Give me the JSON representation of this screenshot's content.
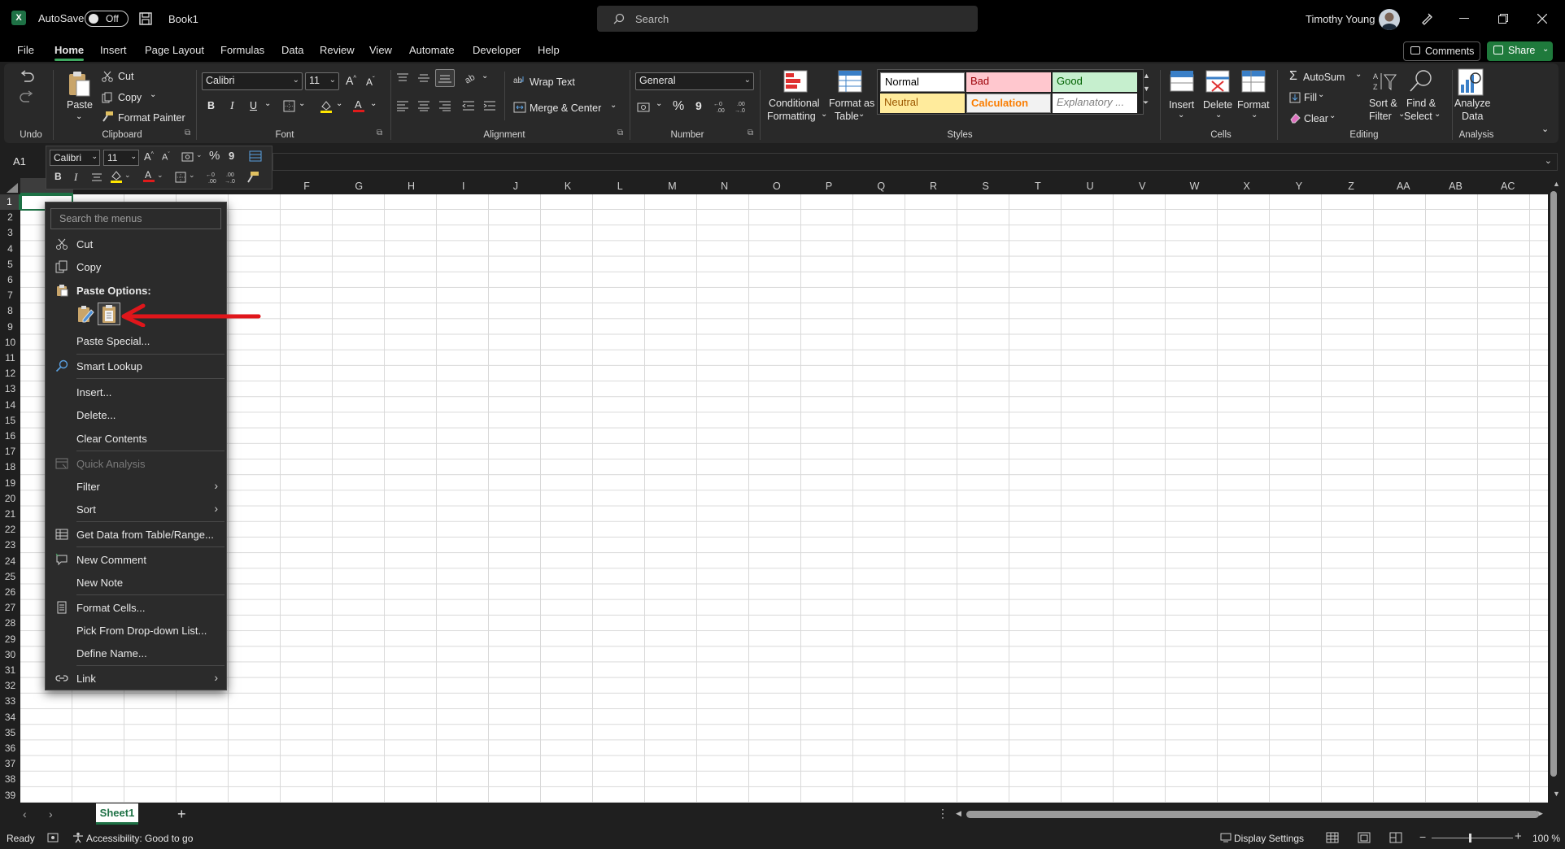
{
  "titlebar": {
    "autosave_label": "AutoSave",
    "autosave_state": "Off",
    "doc_title": "Book1",
    "search_placeholder": "Search",
    "user_name": "Timothy Young"
  },
  "tabs": [
    "File",
    "Home",
    "Insert",
    "Page Layout",
    "Formulas",
    "Data",
    "Review",
    "View",
    "Automate",
    "Developer",
    "Help"
  ],
  "active_tab": "Home",
  "header_buttons": {
    "comments": "Comments",
    "share": "Share"
  },
  "ribbon": {
    "undo_group": "Undo",
    "clipboard": {
      "paste": "Paste",
      "cut": "Cut",
      "copy": "Copy",
      "format_painter": "Format Painter",
      "group": "Clipboard"
    },
    "font": {
      "family": "Calibri",
      "size": "11",
      "bold": "B",
      "italic": "I",
      "underline": "U",
      "group": "Font"
    },
    "alignment": {
      "wrap": "Wrap Text",
      "merge": "Merge & Center",
      "group": "Alignment"
    },
    "number": {
      "format": "General",
      "percent": "%",
      "comma": "9",
      "group": "Number"
    },
    "styles": {
      "conditional_1": "Conditional",
      "conditional_2": "Formatting",
      "format_table_1": "Format as",
      "format_table_2": "Table",
      "normal": "Normal",
      "bad": "Bad",
      "good": "Good",
      "neutral": "Neutral",
      "calculation": "Calculation",
      "explanatory": "Explanatory ...",
      "group": "Styles"
    },
    "cells": {
      "insert": "Insert",
      "delete": "Delete",
      "format": "Format",
      "group": "Cells"
    },
    "editing": {
      "autosum": "AutoSum",
      "fill": "Fill",
      "clear": "Clear",
      "sort_1": "Sort &",
      "sort_2": "Filter",
      "find_1": "Find &",
      "find_2": "Select",
      "group": "Editing"
    },
    "analysis": {
      "analyze_1": "Analyze",
      "analyze_2": "Data",
      "group": "Analysis"
    }
  },
  "namebox": "A1",
  "mini_toolbar": {
    "font": "Calibri",
    "size": "11",
    "bold": "B",
    "italic": "I",
    "percent": "%",
    "comma": "9"
  },
  "columns": [
    "F",
    "G",
    "H",
    "I",
    "J",
    "K",
    "L",
    "M",
    "N",
    "O",
    "P",
    "Q",
    "R",
    "S",
    "T",
    "U",
    "V",
    "W",
    "X",
    "Y",
    "Z",
    "AA",
    "AB",
    "AC"
  ],
  "rows": [
    "1",
    "2",
    "3",
    "4",
    "5",
    "6",
    "7",
    "8",
    "9",
    "10",
    "11",
    "12",
    "13",
    "14",
    "15",
    "16",
    "17",
    "18",
    "19",
    "20",
    "21",
    "22",
    "23",
    "24",
    "25",
    "26",
    "27",
    "28",
    "29",
    "30",
    "31",
    "32",
    "33",
    "34",
    "35",
    "36",
    "37",
    "38",
    "39"
  ],
  "context_menu": {
    "search_placeholder": "Search the menus",
    "cut": "Cut",
    "copy": "Copy",
    "paste_options": "Paste Options:",
    "paste_special": "Paste Special...",
    "smart_lookup": "Smart Lookup",
    "insert": "Insert...",
    "delete": "Delete...",
    "clear_contents": "Clear Contents",
    "quick_analysis": "Quick Analysis",
    "filter": "Filter",
    "sort": "Sort",
    "get_data": "Get Data from Table/Range...",
    "new_comment": "New Comment",
    "new_note": "New Note",
    "format_cells": "Format Cells...",
    "pick_list": "Pick From Drop-down List...",
    "define_name": "Define Name...",
    "link": "Link"
  },
  "sheet_tab": "Sheet1",
  "statusbar": {
    "ready": "Ready",
    "accessibility": "Accessibility: Good to go",
    "display_settings": "Display Settings",
    "zoom": "100 %"
  },
  "colors": {
    "accent": "#1e7145",
    "share": "#1f7a3c",
    "arrow": "#e0161b"
  }
}
